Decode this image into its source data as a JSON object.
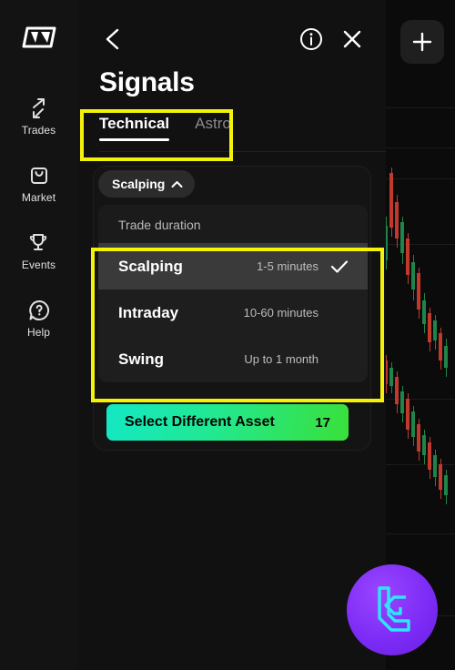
{
  "sidebar": {
    "brand_icon": "parallelogram-logo-icon",
    "items": [
      {
        "label": "Trades",
        "icon": "exchange-arrows-icon"
      },
      {
        "label": "Market",
        "icon": "shopping-bag-icon"
      },
      {
        "label": "Events",
        "icon": "trophy-icon"
      },
      {
        "label": "Help",
        "icon": "question-bubble-icon"
      }
    ]
  },
  "header": {
    "back_icon": "chevron-left-icon",
    "info_icon": "info-circle-icon",
    "close_icon": "close-x-icon",
    "title": "Signals",
    "tabs": [
      {
        "label": "Technical",
        "active": true
      },
      {
        "label": "Astro",
        "active": false
      }
    ]
  },
  "filter": {
    "chip_label": "Scalping",
    "chip_icon": "chevron-up-icon",
    "dropdown_label": "Trade duration",
    "options": [
      {
        "name": "Scalping",
        "meta": "1-5 minutes",
        "selected": true
      },
      {
        "name": "Intraday",
        "meta": "10-60 minutes",
        "selected": false
      },
      {
        "name": "Swing",
        "meta": "Up to 1 month",
        "selected": false
      }
    ],
    "check_icon": "checkmark-icon"
  },
  "cta": {
    "label": "Select Different Asset",
    "count": "17"
  },
  "chart_panel": {
    "add_icon": "plus-icon"
  },
  "watermark": {
    "icon": "lc-monogram-logo"
  },
  "colors": {
    "accent_yellow": "#f5f20a",
    "cta_gradient_start": "#14e8c4",
    "cta_gradient_end": "#3ae03a",
    "watermark_purple": "#7b2bf5",
    "watermark_cyan": "#2ee6ff",
    "panel_bg": "#111111",
    "selected_row": "#3a3a3a"
  }
}
